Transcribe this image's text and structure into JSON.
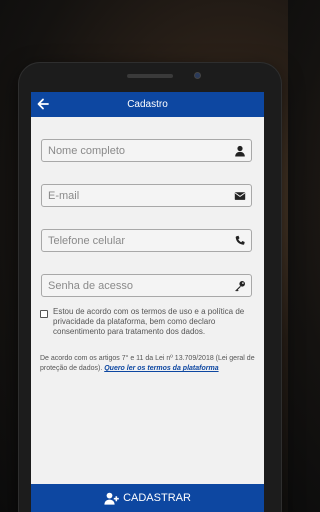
{
  "appbar": {
    "title": "Cadastro"
  },
  "form": {
    "name": {
      "placeholder": "Nome completo",
      "value": ""
    },
    "email": {
      "placeholder": "E-mail",
      "value": ""
    },
    "phone": {
      "placeholder": "Telefone celular",
      "value": ""
    },
    "password": {
      "placeholder": "Senha de acesso",
      "value": ""
    }
  },
  "terms": {
    "checked": false,
    "text": "Estou de acordo com os termos de uso e a política de privacidade da plataforma, bem como declaro consentimento para tratamento dos dados."
  },
  "legal": {
    "text": "De acordo com os artigos 7° e 11 da Lei nº 13.709/2018 (Lei geral de proteção de dados). ",
    "link": "Quero ler os termos da plataforma"
  },
  "submit": {
    "label": "CADASTRAR"
  },
  "colors": {
    "primary": "#0d47a1",
    "background": "#f1f1f1"
  },
  "icons": [
    "arrow-left-icon",
    "user-icon",
    "envelope-icon",
    "phone-icon",
    "key-icon",
    "user-plus-icon"
  ]
}
